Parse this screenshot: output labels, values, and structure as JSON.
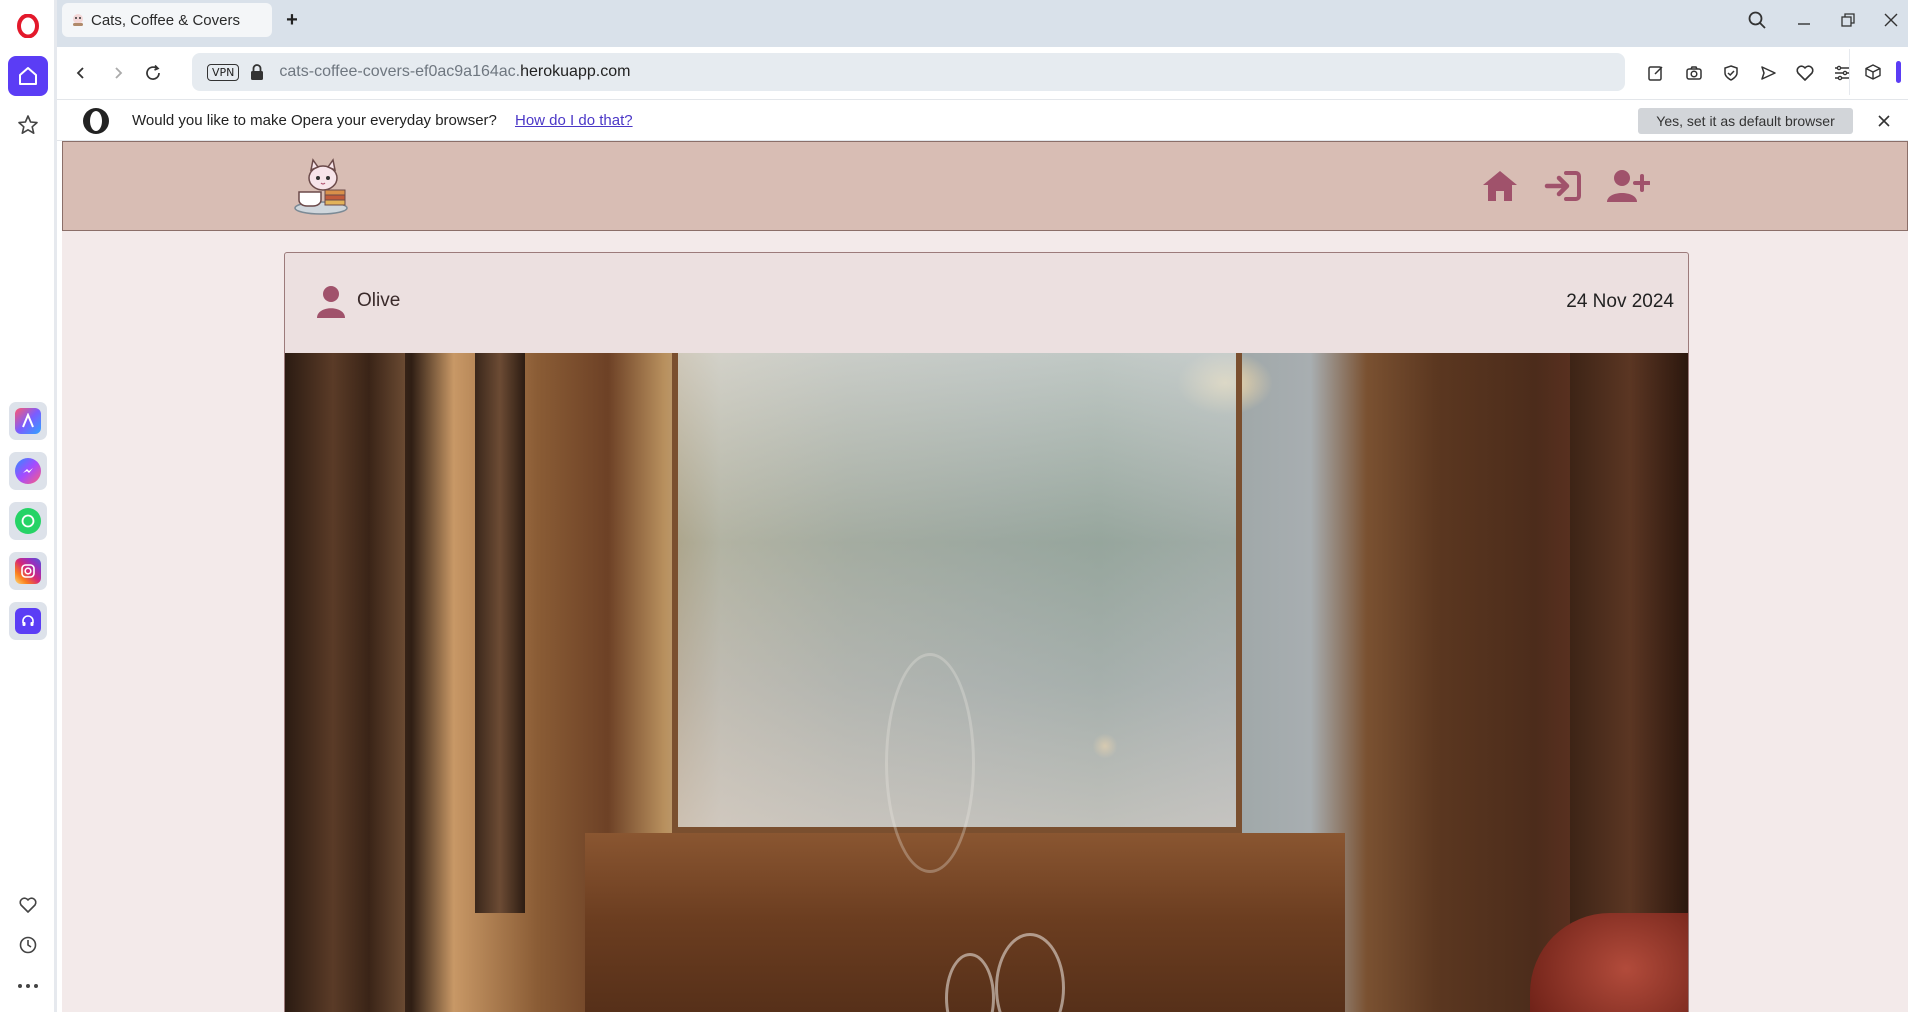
{
  "browser": {
    "tab_title": "Cats, Coffee & Covers",
    "url_subdomain": "cats-coffee-covers-ef0ac9a164ac.",
    "url_domain": "herokuapp.com",
    "vpn_label": "VPN",
    "accent_color": "#5b3df5"
  },
  "default_bar": {
    "message": "Would you like to make Opera your everyday browser?",
    "link_text": "How do I do that?",
    "button_label": "Yes, set it as default browser"
  },
  "sidebar": {
    "top_items": [
      "opera-logo-icon",
      "home-icon",
      "star-icon"
    ],
    "apps": [
      "aria-icon",
      "messenger-icon",
      "whatsapp-icon",
      "instagram-icon",
      "music-player-icon"
    ],
    "bottom_items": [
      "heart-icon",
      "history-icon",
      "more-icon"
    ]
  },
  "site": {
    "nav_icons": [
      "home-icon",
      "sign-in-icon",
      "register-icon"
    ],
    "brand_color": "#a0526b",
    "header_bg": "#d8bdb4",
    "page_bg": "#f3eaea"
  },
  "post": {
    "author": "Olive",
    "date": "24 Nov 2024"
  }
}
